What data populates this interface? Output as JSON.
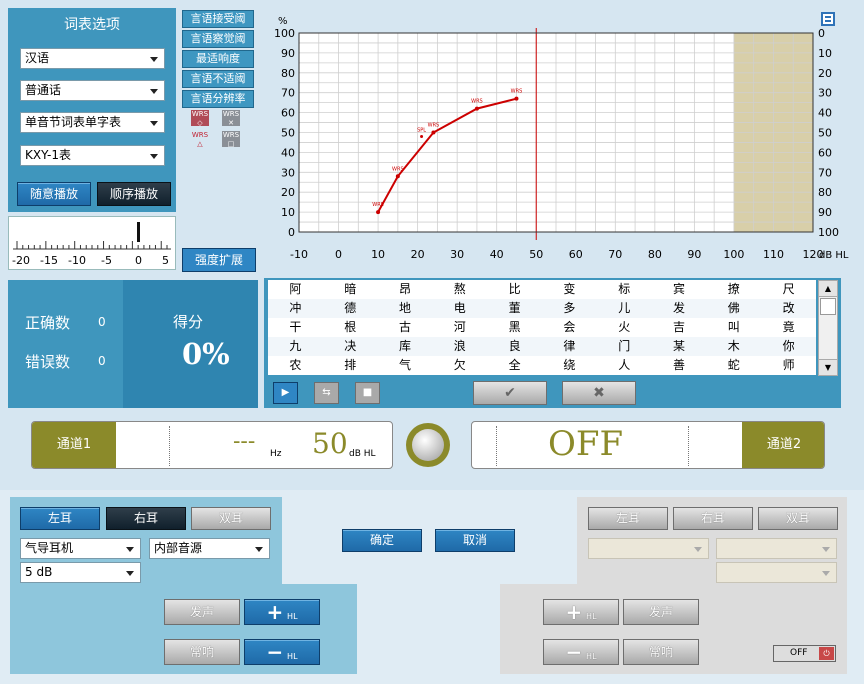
{
  "wordlist_panel": {
    "title": "词表选项",
    "language": "汉语",
    "dialect": "普通话",
    "list_type": "单音节词表单字表",
    "list_name": "KXY-1表",
    "random_play": "随意播放",
    "sequential_play": "顺序播放",
    "slider_ticks": [
      "-20",
      "-15",
      "-10",
      "-5",
      "0",
      "5"
    ]
  },
  "test_modes": [
    "言语接受阈",
    "言语察觉阈",
    "最适响度",
    "言语不适阈",
    "言语分辨率"
  ],
  "wrs_icons": [
    "WRS",
    "WRS",
    "WRS",
    "WRS"
  ],
  "intensity_expand": "强度扩展",
  "chart_data": {
    "type": "line",
    "ylabel": "%",
    "xlabel": "dB HL",
    "x_ticks": [
      "-10",
      "0",
      "10",
      "20",
      "30",
      "40",
      "50",
      "60",
      "70",
      "80",
      "90",
      "100",
      "110",
      "120"
    ],
    "y_ticks_left": [
      "100",
      "90",
      "80",
      "70",
      "60",
      "50",
      "40",
      "30",
      "20",
      "10",
      "0"
    ],
    "y_ticks_right": [
      "0",
      "10",
      "20",
      "30",
      "40",
      "50",
      "60",
      "70",
      "80",
      "90",
      "100"
    ],
    "xlim": [
      -10,
      120
    ],
    "ylim": [
      0,
      100
    ],
    "marker_x": 50,
    "grid": true,
    "series": [
      {
        "x": [
          10,
          15,
          24,
          35,
          45
        ],
        "y": [
          10,
          28,
          50,
          62,
          67
        ]
      }
    ],
    "scatter_x": [
      21
    ],
    "scatter_y": [
      48
    ],
    "marker_label": "WRS",
    "scatter_label": "SPL",
    "color": "#cc0000"
  },
  "score_panel": {
    "correct_label": "正确数",
    "correct_value": "0",
    "wrong_label": "错误数",
    "wrong_value": "0",
    "score_label": "得分",
    "score_value": "0%"
  },
  "word_rows": [
    [
      "阿",
      "暗",
      "昂",
      "熬",
      "比",
      "变",
      "标",
      "宾",
      "撩",
      "尺"
    ],
    [
      "冲",
      "德",
      "地",
      "电",
      "董",
      "多",
      "儿",
      "发",
      "佛",
      "改"
    ],
    [
      "干",
      "根",
      "古",
      "河",
      "黑",
      "会",
      "火",
      "吉",
      "叫",
      "竟"
    ],
    [
      "九",
      "决",
      "库",
      "浪",
      "良",
      "律",
      "门",
      "某",
      "木",
      "你"
    ],
    [
      "农",
      "排",
      "气",
      "欠",
      "全",
      "绕",
      "人",
      "善",
      "蛇",
      "师"
    ]
  ],
  "channel1": {
    "label": "通道1",
    "freq": "---",
    "freq_unit": "Hz",
    "level": "50",
    "level_unit": "dB HL"
  },
  "channel2": {
    "label": "通道2",
    "status": "OFF"
  },
  "left_controls": {
    "left_ear": "左耳",
    "right_ear": "右耳",
    "both_ears": "双耳",
    "transducer": "气导耳机",
    "source": "内部音源",
    "step": "5 dB",
    "present": "发声",
    "plus": "+",
    "plus_unit": "HL",
    "mute": "常响",
    "minus": "−",
    "minus_unit": "HL"
  },
  "ok_button": "确定",
  "cancel_button": "取消",
  "right_controls": {
    "left_ear": "左耳",
    "right_ear": "右耳",
    "both_ears": "双耳",
    "plus": "+",
    "plus_unit": "HL",
    "present": "发声",
    "minus": "−",
    "minus_unit": "HL",
    "mute": "常响",
    "off_label": "OFF"
  }
}
